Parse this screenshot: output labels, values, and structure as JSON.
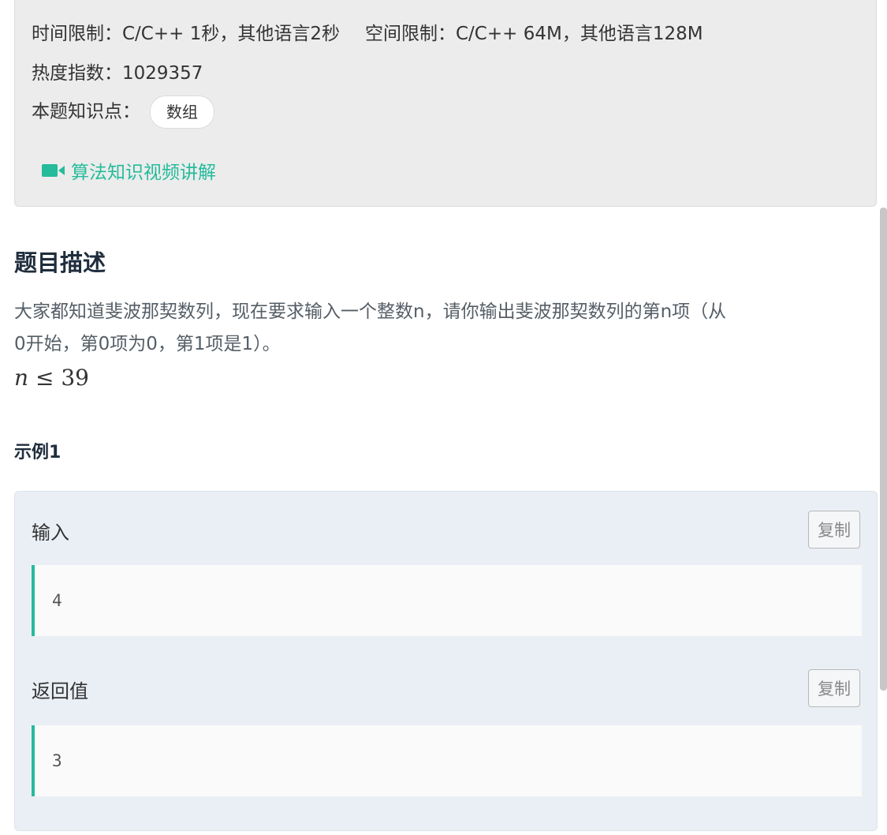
{
  "limits": {
    "time": "时间限制：C/C++ 1秒，其他语言2秒",
    "space": "空间限制：C/C++ 64M，其他语言128M"
  },
  "heat": "热度指数：1029357",
  "knowledge": {
    "label": "本题知识点：",
    "tags": [
      "数组"
    ]
  },
  "video_link": {
    "icon": "video-camera-icon",
    "label": "算法知识视频讲解"
  },
  "problem": {
    "title": "题目描述",
    "lines": [
      "大家都知道斐波那契数列，现在要求输入一个整数n，请你输出斐波那契数列的第n项（从",
      "0开始，第0项为0，第1项是1）。"
    ],
    "constraint": {
      "var": "n",
      "op": "≤",
      "value": "39"
    }
  },
  "example": {
    "title": "示例1",
    "input_label": "输入",
    "input_value": "4",
    "output_label": "返回值",
    "output_value": "3",
    "copy_label": "复制"
  },
  "colors": {
    "accent": "#25bb9b",
    "panel_bg": "#ececec",
    "example_bg": "#eaeff5"
  }
}
